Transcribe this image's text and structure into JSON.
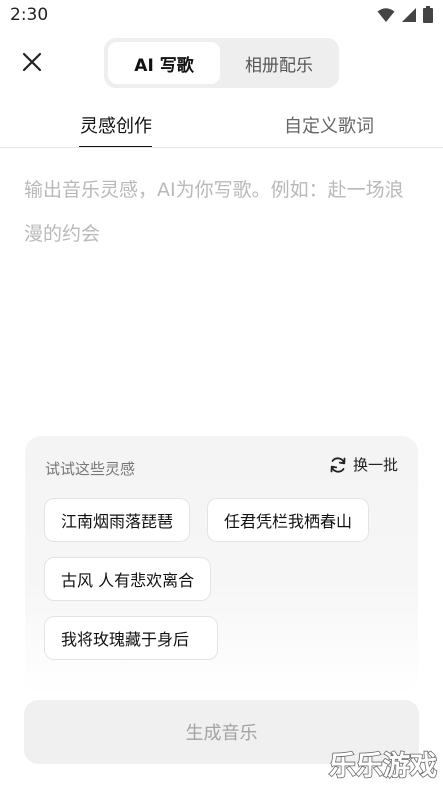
{
  "status_bar": {
    "time": "2:30",
    "icons": [
      "wifi-icon",
      "signal-icon",
      "battery-icon"
    ]
  },
  "header": {
    "close_icon": "close-icon",
    "mode_tabs": [
      {
        "label": "AI 写歌",
        "active": true
      },
      {
        "label": "相册配乐",
        "active": false
      }
    ]
  },
  "sub_tabs": [
    {
      "label": "灵感创作",
      "active": true
    },
    {
      "label": "自定义歌词",
      "active": false
    }
  ],
  "prompt": {
    "placeholder": "输出音乐灵感，AI为你写歌。例如：赴一场浪漫的约会",
    "value": ""
  },
  "inspiration": {
    "title": "试试这些灵感",
    "refresh_label": "换一批",
    "refresh_icon": "refresh-icon",
    "chips": [
      "江南烟雨落琵琶",
      "任君凭栏我栖春山",
      "古风 人有悲欢离合",
      "我将玫瑰藏于身后"
    ]
  },
  "generate_button": {
    "label": "生成音乐"
  },
  "watermark": {
    "text": "乐乐游戏"
  }
}
